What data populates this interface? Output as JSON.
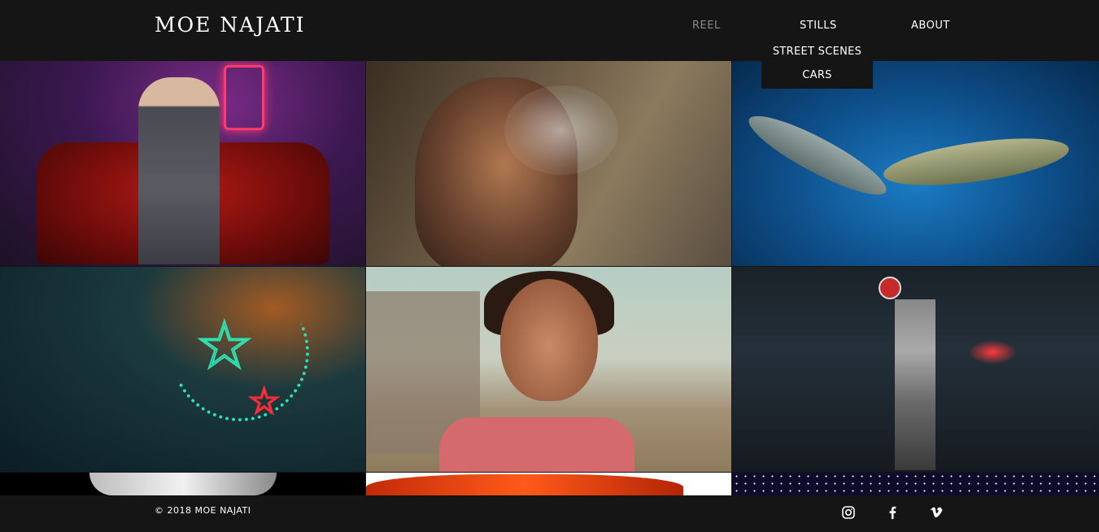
{
  "header": {
    "logo": "MOE NAJATI",
    "nav": {
      "reel": "REEL",
      "stills": "STILLS",
      "about": "ABOUT"
    },
    "dropdown": [
      "STREET SCENES",
      "CARS"
    ]
  },
  "gallery": {
    "photos": [
      "man-on-red-sofa-photo",
      "woman-smoking-photo",
      "fish-on-blue-fabric-photo",
      "neon-crescent-star-photo",
      "smiling-girl-photo",
      "robot-workshop-photo",
      "black-white-partial-photo",
      "red-car-partial-photo",
      "starry-sky-partial-photo"
    ]
  },
  "footer": {
    "copyright": "© 2018 MOE NAJATI",
    "social": [
      "instagram-icon",
      "facebook-icon",
      "vimeo-icon"
    ]
  },
  "colors": {
    "background": "#151515",
    "text": "#ffffff",
    "nav_inactive": "#8b8b8b"
  }
}
